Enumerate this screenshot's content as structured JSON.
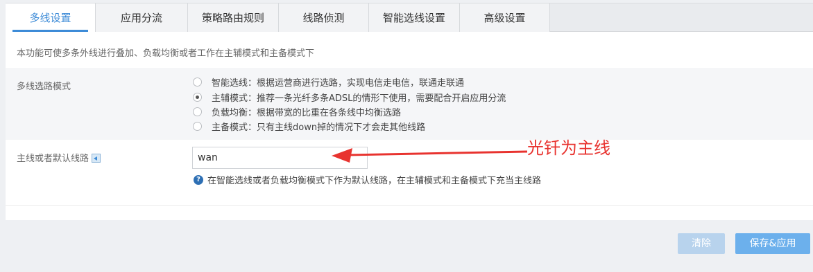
{
  "tabs": [
    {
      "label": "多线设置",
      "active": true
    },
    {
      "label": "应用分流",
      "active": false
    },
    {
      "label": "策略路由规则",
      "active": false
    },
    {
      "label": "线路侦测",
      "active": false
    },
    {
      "label": "智能选线设置",
      "active": false
    },
    {
      "label": "高级设置",
      "active": false
    }
  ],
  "description": "本功能可使多条外线进行叠加、负载均衡或者工作在主辅模式和主备模式下",
  "mode": {
    "label": "多线选路模式",
    "options": [
      {
        "label": "智能选线：根据运营商进行选路，实现电信走电信，联通走联通",
        "checked": false
      },
      {
        "label": "主辅模式：推荐一条光纤多条ADSL的情形下使用，需要配合开启应用分流",
        "checked": true
      },
      {
        "label": "负载均衡：根据带宽的比重在各条线中均衡选路",
        "checked": false
      },
      {
        "label": "主备模式：只有主线down掉的情况下才会走其他线路",
        "checked": false
      }
    ]
  },
  "default_line": {
    "label": "主线或者默认线路",
    "value": "wan",
    "help": "在智能选线或者负载均衡模式下作为默认线路，在主辅模式和主备模式下充当主线路"
  },
  "annotation": {
    "text": "光钎为主线",
    "color": "#e8332f"
  },
  "buttons": {
    "clear": "清除",
    "save": "保存&应用"
  },
  "colors": {
    "accent": "#3d8bd7",
    "save_button": "#6cb0ec",
    "clear_button": "#b8d3ed"
  }
}
